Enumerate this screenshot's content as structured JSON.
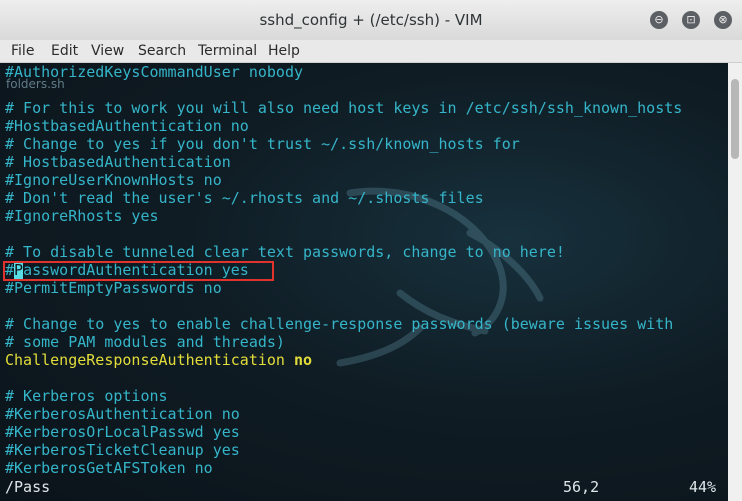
{
  "window": {
    "title": "sshd_config + (/etc/ssh) - VIM"
  },
  "controls": {
    "minimize": "⊖",
    "maximize": "⊡",
    "close": "⊗"
  },
  "menu": [
    "File",
    "Edit",
    "View",
    "Search",
    "Terminal",
    "Help"
  ],
  "desktop": {
    "ghost_label": "folders.sh"
  },
  "editor": {
    "lines": [
      {
        "type": "comment",
        "text": "#AuthorizedKeysCommandUser nobody"
      },
      {
        "type": "comment",
        "text": ""
      },
      {
        "type": "comment",
        "text": "# For this to work you will also need host keys in /etc/ssh/ssh_known_hosts"
      },
      {
        "type": "comment",
        "text": "#HostbasedAuthentication no"
      },
      {
        "type": "comment",
        "text": "# Change to yes if you don't trust ~/.ssh/known_hosts for"
      },
      {
        "type": "comment",
        "text": "# HostbasedAuthentication"
      },
      {
        "type": "comment",
        "text": "#IgnoreUserKnownHosts no"
      },
      {
        "type": "comment",
        "text": "# Don't read the user's ~/.rhosts and ~/.shosts files"
      },
      {
        "type": "comment",
        "text": "#IgnoreRhosts yes"
      },
      {
        "type": "comment",
        "text": ""
      },
      {
        "type": "comment",
        "text": "# To disable tunneled clear text passwords, change to no here!"
      },
      {
        "type": "cursor",
        "before": "#",
        "cursor": "P",
        "after": "asswordAuthentication yes"
      },
      {
        "type": "comment",
        "text": "#PermitEmptyPasswords no"
      },
      {
        "type": "comment",
        "text": ""
      },
      {
        "type": "comment",
        "text": "# Change to yes to enable challenge-response passwords (beware issues with"
      },
      {
        "type": "comment",
        "text": "# some PAM modules and threads)"
      },
      {
        "type": "setting",
        "key": "ChallengeResponseAuthentication",
        "value": "no"
      },
      {
        "type": "comment",
        "text": ""
      },
      {
        "type": "comment",
        "text": "# Kerberos options"
      },
      {
        "type": "comment",
        "text": "#KerberosAuthentication no"
      },
      {
        "type": "comment",
        "text": "#KerberosOrLocalPasswd yes"
      },
      {
        "type": "comment",
        "text": "#KerberosTicketCleanup yes"
      },
      {
        "type": "comment",
        "text": "#KerberosGetAFSToken no"
      }
    ]
  },
  "status": {
    "command": "/Pass",
    "position": "56,2",
    "percent": "44%"
  },
  "colors": {
    "comment": "#35b5c9",
    "setting": "#e3dd3a",
    "highlight_box": "#e0332e",
    "cursor": "#58dfe6"
  }
}
